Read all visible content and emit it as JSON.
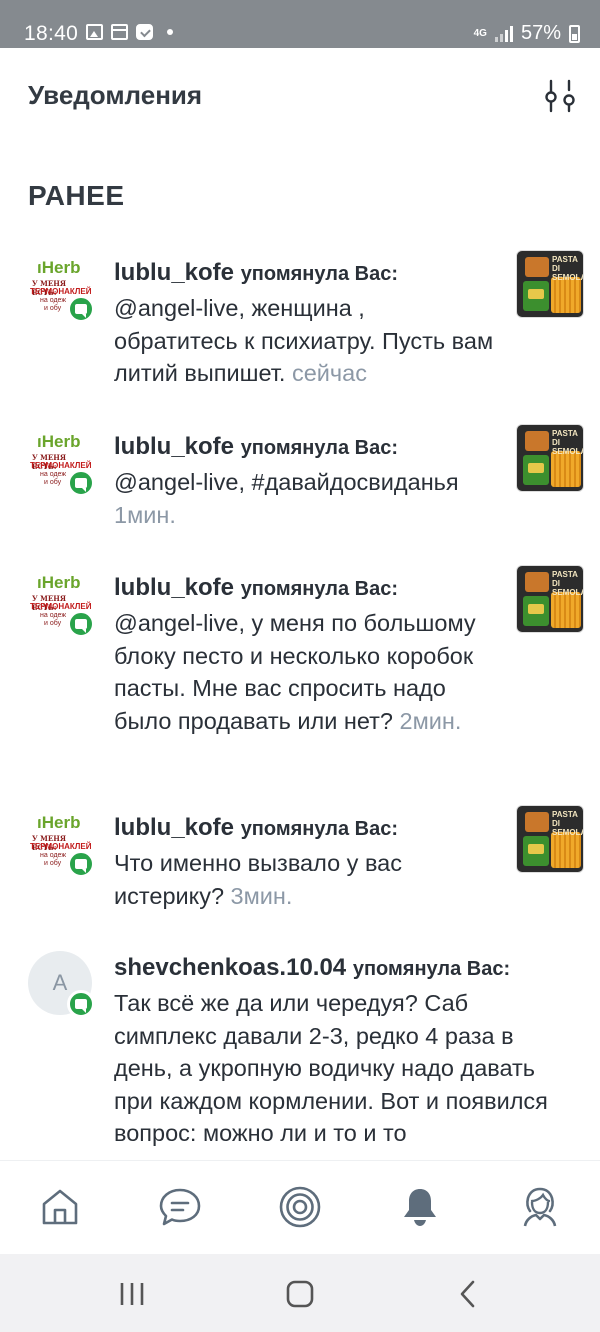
{
  "status_bar": {
    "time": "18:40",
    "network": "4G",
    "battery": "57%",
    "left_icons": [
      "gallery-icon",
      "calendar-icon",
      "mail-icon",
      "dot-icon"
    ]
  },
  "header": {
    "title": "Уведомления",
    "filter_icon": "filter-sliders-icon"
  },
  "section": {
    "title": "РАНЕЕ"
  },
  "notifications": [
    {
      "username": "lublu_kofe",
      "action": "упомянула Вас:",
      "text": "@angel-live, женщина , обратитесь к психиатру.  Пусть вам литий выпишет.",
      "time": "сейчас",
      "avatar": "iherb-avatar",
      "thumbnail": true
    },
    {
      "username": "lublu_kofe",
      "action": "упомянула Вас:",
      "text": "@angel-live, #давайдосвиданья",
      "time": "1мин.",
      "avatar": "iherb-avatar",
      "thumbnail": true
    },
    {
      "username": "lublu_kofe",
      "action": "упомянула Вас:",
      "text": "@angel-live, у меня по большому блоку песто и несколько коробок пасты.  Мне вас спросить надо было продавать или нет?",
      "time": "2мин.",
      "avatar": "iherb-avatar",
      "thumbnail": true
    },
    {
      "username": "lublu_kofe",
      "action": "упомянула Вас:",
      "text": "Что именно вызвало у вас истерику?",
      "time": "3мин.",
      "avatar": "iherb-avatar",
      "thumbnail": true
    },
    {
      "username": "shevchenkoas.10.04",
      "action": "упомянула Вас:",
      "text": "Так всё же да или чередуя?  Саб симплекс давали 2-3, редко 4 раза в день, а укропную водичку надо давать при каждом кормлении. Вот и появился вопрос: можно ли и то и то",
      "time": "",
      "avatar_letter": "A",
      "thumbnail": false
    }
  ],
  "avatar_text": {
    "brand": "iHerb",
    "line1": "У МЕНЯ ЕСТЬ:",
    "line2": "ТЕРМОНАКЛЕЙКИ",
    "line3": "на одеж",
    "line4": "и обу"
  },
  "thumbnail_text": "PASTA DI SEMOLA",
  "bottom_nav": {
    "items": [
      "home-icon",
      "chat-icon",
      "target-icon",
      "bell-icon",
      "profile-icon"
    ],
    "active": "bell-icon"
  },
  "colors": {
    "status_bar": "#858a8f",
    "badge_green": "#29a34a",
    "time_gray": "#8c98a6",
    "text_dark": "#2a3038",
    "icon_gray": "#5e6d7c"
  }
}
